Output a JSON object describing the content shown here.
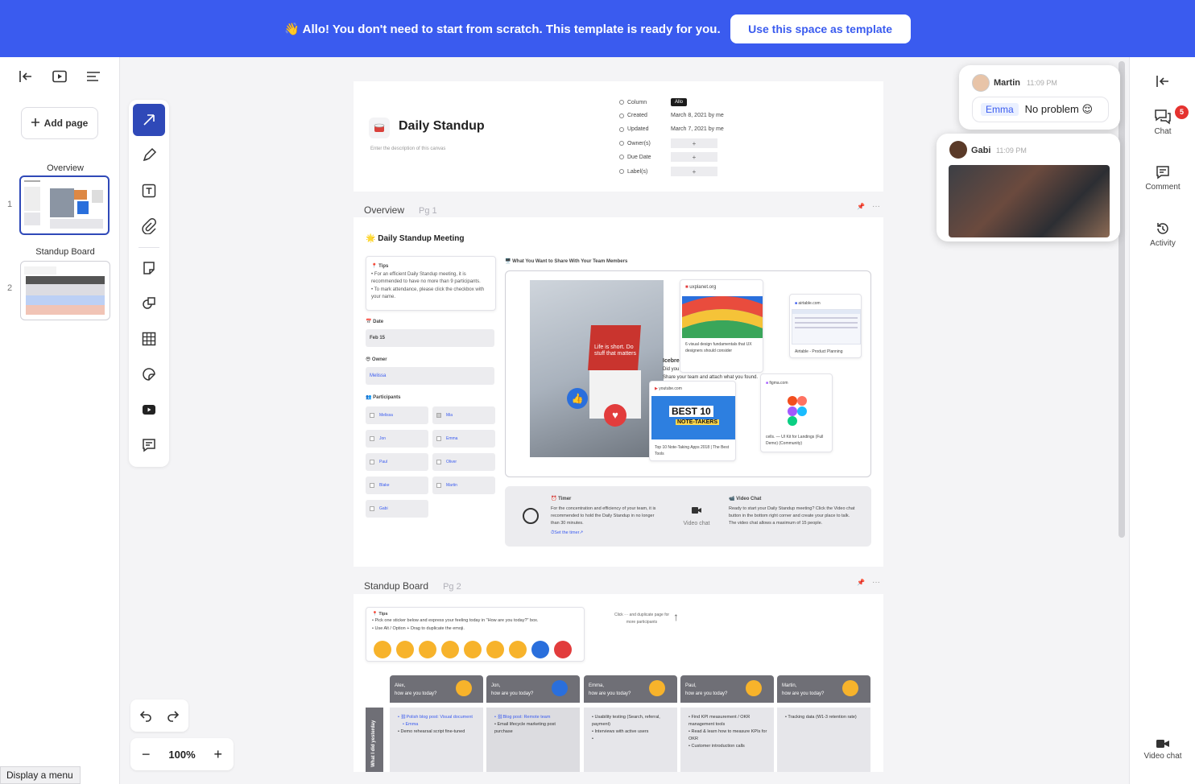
{
  "banner": {
    "text": "👋 Allo! You don't need to start from scratch. This template is ready for you.",
    "button": "Use this space as template"
  },
  "sidebar": {
    "add_page": "Add page",
    "pages": [
      {
        "num": "1",
        "label": "Overview"
      },
      {
        "num": "2",
        "label": "Standup Board"
      }
    ]
  },
  "doc": {
    "title": "Daily Standup",
    "description": "Enter the description of this canvas",
    "meta": [
      {
        "key": "Column",
        "value": "Allo"
      },
      {
        "key": "Created",
        "value": "March 8, 2021 by me"
      },
      {
        "key": "Updated",
        "value": "March 7, 2021 by me"
      },
      {
        "key": "Owner(s)",
        "value": "+"
      },
      {
        "key": "Due Date",
        "value": "+"
      },
      {
        "key": "Label(s)",
        "value": "+"
      }
    ]
  },
  "overview": {
    "header": "Overview",
    "pg": "Pg 1",
    "meeting_title": "🌟 Daily Standup Meeting",
    "tips_title": "📍 Tips",
    "tips": [
      "For an efficient Daily Standup meeting, it is recommended to have no more than 9 participants.",
      "To mark attendance, please click the checkbox with your name."
    ],
    "date_label": "📅 Date",
    "date_value": "Feb 15",
    "owner_label": "😎 Owner",
    "owner_value": "Melissa",
    "participants_label": "👥 Participants",
    "participants": [
      "Melissa",
      "Mia",
      "Jon",
      "Emma",
      "Paul",
      "Oliver",
      "Blake",
      "Martin",
      "Gabi"
    ],
    "share_title": "🖥️ What You Want to Share With Your Team Members",
    "sticky_text": "Life is short. Do stuff that matters",
    "icebreaker": [
      "Icebreaker time 🔨",
      "Did you find something interesting?",
      "Share your team and attach what you found."
    ],
    "links": [
      {
        "domain": "uxplanet.org",
        "title": "6 visual design fundamentals that UX designers should consider"
      },
      {
        "domain": "airtable.com",
        "title": "Airtable - Product Planning"
      },
      {
        "domain": "youtube.com",
        "title": "Top 10 Note-Taking Apps 2018 | The Best Tools"
      },
      {
        "domain": "figma.com",
        "title": "cells. — UI Kit for Landings (Full Demo) (Community)"
      }
    ],
    "yt_banner": [
      "BEST 10",
      "NOTE-TAKERS"
    ],
    "timer_title": "⏰ Timer",
    "timer_text": "For the concentration and efficiency of your team, it is recommended to hold the Daily Standup in no longer than 30 minutes.",
    "timer_link": "⏱Set the timer↗",
    "video_label": "Video chat",
    "videochat_title": "📹 Video Chat",
    "videochat_text": "Ready to start your Daily Standup meeting? Click the Video chat button in the bottom right corner and create your place to talk. The video chat allows a maximum of 15 people."
  },
  "board": {
    "header": "Standup Board",
    "pg": "Pg 2",
    "tips_title": "📍 Tips",
    "tips": [
      "Pick one sticker below and express your feeling today in \"How are you today?\" box.",
      "Use Alt / Option + Drag to duplicate the emoji."
    ],
    "dup_note": "Click ··· and duplicate page for more participants",
    "row_label": "What I did yesterday",
    "columns": [
      {
        "name": "Alex,",
        "q": "how are you today?",
        "items": [
          "⛓Polish blog post: Visual document",
          "Emma",
          "Demo rehearsal script fine-tuned"
        ]
      },
      {
        "name": "Jon,",
        "q": "how are you today?",
        "items": [
          "⛓Blog post: Remote team",
          "Email lifecycle marketing post purchase"
        ]
      },
      {
        "name": "Emma,",
        "q": "how are you today?",
        "items": [
          "Usability testing (Search, referral, payment)",
          "Interviews with active users",
          ""
        ]
      },
      {
        "name": "Paul,",
        "q": "how are you today?",
        "items": [
          "Find KPI measurement / OKR management tools",
          "Read & learn how to measure KPIs for OKR",
          "Customer introduction calls"
        ]
      },
      {
        "name": "Martin,",
        "q": "how are you today?",
        "items": [
          "Tracking data (W1-3 retention rate)"
        ]
      }
    ]
  },
  "comments": [
    {
      "name": "Martin",
      "time": "11:09 PM",
      "mention": "Emma",
      "text": "No problem 😌"
    },
    {
      "name": "Gabi",
      "time": "11:09 PM"
    }
  ],
  "right_sidebar": {
    "chat": "Chat",
    "chat_badge": "5",
    "comment": "Comment",
    "activity": "Activity",
    "video_chat": "Video chat"
  },
  "zoom": {
    "level": "100%",
    "minus": "−",
    "plus": "+"
  },
  "tooltip": "Display a menu",
  "colors": {
    "accent": "#3a5bef",
    "tool_active": "#2f49b8",
    "badge": "#e5322f"
  }
}
